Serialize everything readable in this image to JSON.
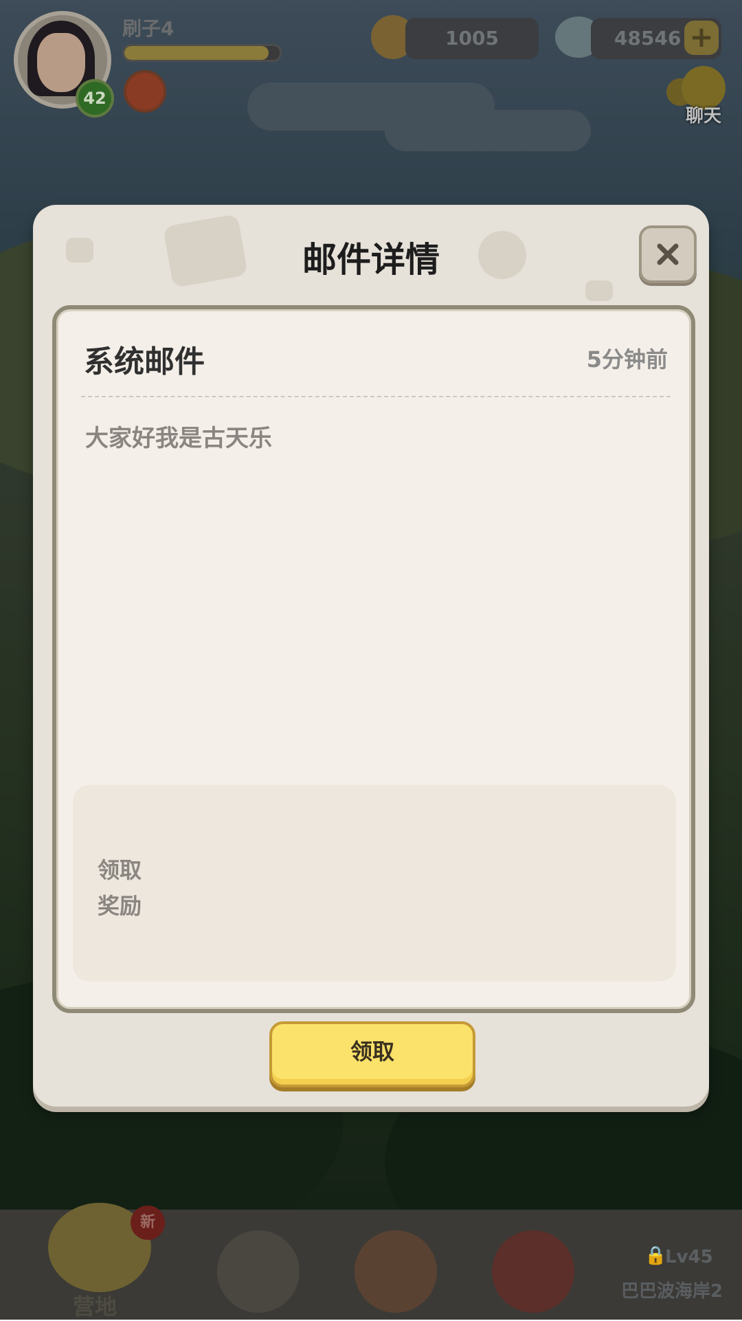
{
  "hud": {
    "player_name": "刷子4",
    "level": "42",
    "exp_progress": 0.93,
    "currency_a": "1005",
    "currency_b": "48546",
    "plus_icon": "plus-icon",
    "chat_label": "聊天"
  },
  "modal": {
    "title": "邮件详情",
    "close_icon": "close-icon",
    "mail": {
      "heading": "系统邮件",
      "time": "5分钟前",
      "body": "大家好我是古天乐",
      "reward_line1": "领取",
      "reward_line2": "奖励"
    },
    "claim_label": "领取"
  },
  "bottom_nav": {
    "camp_label": "营地",
    "new_badge": "新",
    "locked_level": "Lv45",
    "locked_stage": "巴巴波海岸2"
  },
  "colors": {
    "accent_yellow": "#fbe26a",
    "card_bg": "#f4efe8",
    "modal_bg": "#e6e1d9"
  }
}
